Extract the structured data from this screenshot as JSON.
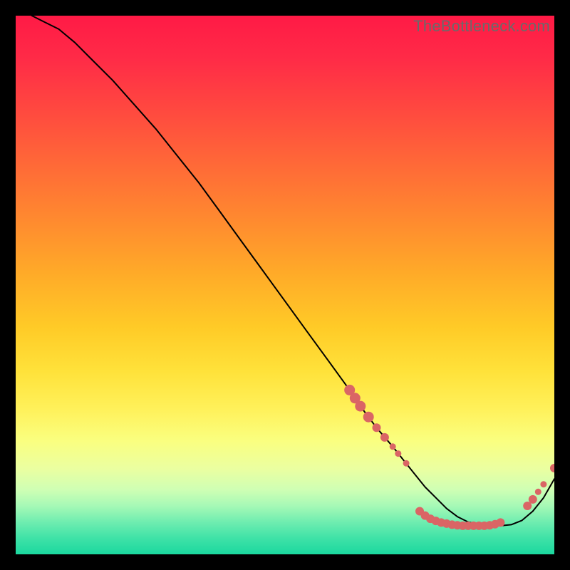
{
  "watermark": "TheBottleneck.com",
  "chart_data": {
    "type": "line",
    "title": "",
    "xlabel": "",
    "ylabel": "",
    "xlim": [
      0,
      100
    ],
    "ylim": [
      0,
      100
    ],
    "series": [
      {
        "name": "bottleneck-curve",
        "x": [
          3,
          5,
          8,
          11,
          14,
          18,
          22,
          26,
          30,
          34,
          38,
          42,
          46,
          50,
          54,
          58,
          62,
          64,
          67,
          70,
          72,
          74,
          76,
          78,
          80,
          82,
          84,
          86,
          88,
          90,
          92,
          94,
          96,
          98,
          100
        ],
        "y": [
          100,
          99,
          97.5,
          95,
          92,
          88,
          83.5,
          79,
          74,
          69,
          63.5,
          58,
          52.5,
          47,
          41.5,
          36,
          30.5,
          27.5,
          23.5,
          20,
          17.5,
          15,
          12.5,
          10.5,
          8.5,
          7,
          6,
          5.5,
          5.3,
          5.3,
          5.5,
          6.3,
          8,
          10.5,
          14
        ]
      }
    ],
    "markers": [
      {
        "x": 62,
        "y": 30.5,
        "size": "big"
      },
      {
        "x": 63,
        "y": 29.0,
        "size": "big"
      },
      {
        "x": 64,
        "y": 27.5,
        "size": "big"
      },
      {
        "x": 65.5,
        "y": 25.5,
        "size": "big"
      },
      {
        "x": 67,
        "y": 23.5,
        "size": "med"
      },
      {
        "x": 68.5,
        "y": 21.7,
        "size": "med"
      },
      {
        "x": 70,
        "y": 20.0,
        "size": "sm"
      },
      {
        "x": 71,
        "y": 18.7,
        "size": "sm"
      },
      {
        "x": 72.5,
        "y": 16.9,
        "size": "sm"
      },
      {
        "x": 75,
        "y": 8.0,
        "size": "med"
      },
      {
        "x": 76,
        "y": 7.2,
        "size": "med"
      },
      {
        "x": 77,
        "y": 6.6,
        "size": "med"
      },
      {
        "x": 78,
        "y": 6.2,
        "size": "med"
      },
      {
        "x": 79,
        "y": 5.9,
        "size": "med"
      },
      {
        "x": 80,
        "y": 5.7,
        "size": "med"
      },
      {
        "x": 81,
        "y": 5.5,
        "size": "med"
      },
      {
        "x": 82,
        "y": 5.4,
        "size": "med"
      },
      {
        "x": 83,
        "y": 5.3,
        "size": "med"
      },
      {
        "x": 84,
        "y": 5.3,
        "size": "med"
      },
      {
        "x": 85,
        "y": 5.3,
        "size": "med"
      },
      {
        "x": 86,
        "y": 5.3,
        "size": "med"
      },
      {
        "x": 87,
        "y": 5.3,
        "size": "med"
      },
      {
        "x": 88,
        "y": 5.4,
        "size": "med"
      },
      {
        "x": 89,
        "y": 5.6,
        "size": "med"
      },
      {
        "x": 90,
        "y": 5.9,
        "size": "med"
      },
      {
        "x": 95,
        "y": 9.0,
        "size": "med"
      },
      {
        "x": 96,
        "y": 10.2,
        "size": "med"
      },
      {
        "x": 97,
        "y": 11.6,
        "size": "sm"
      },
      {
        "x": 98,
        "y": 13.0,
        "size": "sm"
      },
      {
        "x": 100,
        "y": 16.0,
        "size": "med"
      }
    ],
    "gradient_stops": [
      {
        "pos": 0.0,
        "color": "#ff1a46"
      },
      {
        "pos": 0.28,
        "color": "#ff6a37"
      },
      {
        "pos": 0.58,
        "color": "#ffcb27"
      },
      {
        "pos": 0.79,
        "color": "#faff80"
      },
      {
        "pos": 1.0,
        "color": "#1bd89f"
      }
    ]
  }
}
